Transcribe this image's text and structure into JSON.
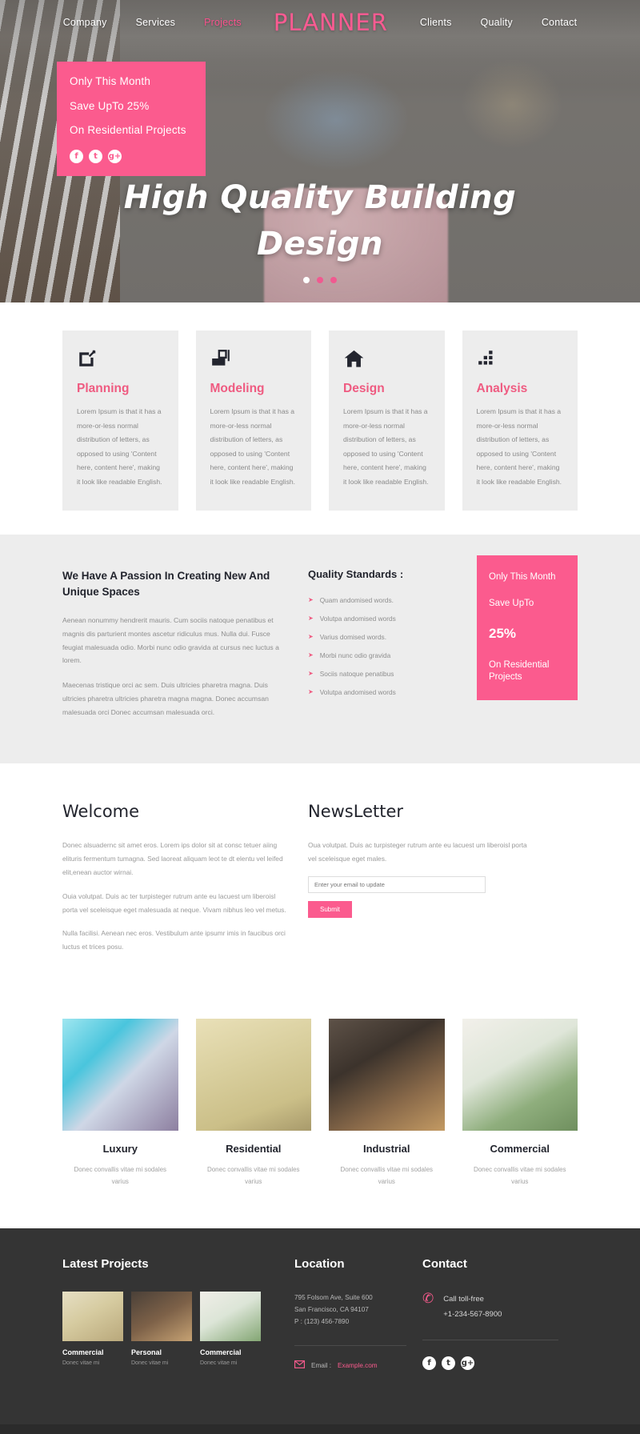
{
  "nav": {
    "brand": "PLANNER",
    "items": [
      {
        "label": "Company",
        "active": false
      },
      {
        "label": "Services",
        "active": false
      },
      {
        "label": "Projects",
        "active": true
      },
      {
        "label": "Clients",
        "active": false
      },
      {
        "label": "Quality",
        "active": false
      },
      {
        "label": "Contact",
        "active": false
      }
    ]
  },
  "hero": {
    "badge": {
      "line1": "Only This Month",
      "line2": "Save UpTo 25%",
      "line3": "On Residential Projects",
      "social": [
        "f",
        "t",
        "g+"
      ]
    },
    "title_line1": "High Quality Building",
    "title_line2": "Design",
    "dots": [
      true,
      false,
      false
    ]
  },
  "services": [
    {
      "icon": "edit-square-icon",
      "title": "Planning",
      "text": "Lorem Ipsum is that it has a more-or-less normal distribution of letters, as opposed to using 'Content here, content here', making it look like readable English."
    },
    {
      "icon": "monitor-icon",
      "title": "Modeling",
      "text": "Lorem Ipsum is that it has a more-or-less normal distribution of letters, as opposed to using 'Content here, content here', making it look like readable English."
    },
    {
      "icon": "home-icon",
      "title": "Design",
      "text": "Lorem Ipsum is that it has a more-or-less normal distribution of letters, as opposed to using 'Content here, content here', making it look like readable English."
    },
    {
      "icon": "bar-chart-icon",
      "title": "Analysis",
      "text": "Lorem Ipsum is that it has a more-or-less normal distribution of letters, as opposed to using 'Content here, content here', making it look like readable English."
    }
  ],
  "passion": {
    "heading": "We Have A Passion In Creating New And Unique Spaces",
    "para1": "Aenean nonummy hendrerit mauris. Cum sociis natoque penatibus et magnis dis parturient montes ascetur ridiculus mus. Nulla dui. Fusce feugiat malesuada odio. Morbi nunc odio gravida at cursus nec luctus a lorem.",
    "para2": "Maecenas tristique orci ac sem. Duis ultricies pharetra magna. Duis ultricies pharetra ultricies pharetra magna magna. Donec accumsan malesuada orci Donec accumsan malesuada orci.",
    "standards_heading": "Quality Standards :",
    "standards": [
      "Quam andomised words.",
      "Volutpa andomised words",
      "Varius domised words.",
      "Morbi nunc odio gravida",
      "Sociis natoque penatibus",
      "Volutpa andomised words"
    ],
    "promo": {
      "line1": "Only This Month",
      "line2": "Save UpTo",
      "line3": "25%",
      "line4": "On Residential Projects"
    }
  },
  "welcome": {
    "heading": "Welcome",
    "para1": "Donec alsuadernc sit amet eros. Lorem ips dolor sit at consc tetuer aiing elituris fermentum tumagna. Sed laoreat aliquam leot te dt elentu vel leifed elit,enean auctor wirnai.",
    "para2": "Ouia volutpat. Duis ac ter turpisteger rutrum ante eu lacuest um liberoisl porta vel sceleisque eget malesuada at neque. Vivam nibhus leo vel metus.",
    "para3": "Nulla facilisi. Aenean nec eros. Vestibulum ante ipsumr imis in faucibus orci luctus et trices posu."
  },
  "newsletter": {
    "heading": "NewsLetter",
    "text": "Oua volutpat. Duis ac turpisteger rutrum ante eu lacuest um liberoisl porta vel sceleisque eget males.",
    "placeholder": "Enter your email to update",
    "input_value": "",
    "submit_label": "Submit"
  },
  "gallery": [
    {
      "image": "luxury-photo",
      "title": "Luxury",
      "text": "Donec convallis vitae mi sodales varius"
    },
    {
      "image": "residential-photo",
      "title": "Residential",
      "text": "Donec convallis vitae mi sodales varius"
    },
    {
      "image": "industrial-photo",
      "title": "Industrial",
      "text": "Donec convallis vitae mi sodales varius"
    },
    {
      "image": "commercial-photo",
      "title": "Commercial",
      "text": "Donec convallis vitae mi sodales varius"
    }
  ],
  "footer": {
    "projects_heading": "Latest Projects",
    "projects": [
      {
        "title": "Commercial",
        "sub": "Donec vitae mi"
      },
      {
        "title": "Personal",
        "sub": "Donec vitae mi"
      },
      {
        "title": "Commercial",
        "sub": "Donec vitae mi"
      }
    ],
    "location_heading": "Location",
    "address_line1": "795 Folsom Ave, Suite 600",
    "address_line2": "San Francisco, CA 94107",
    "address_line3": "P : (123) 456-7890",
    "email_label": "Email :",
    "email_value": "Example.com",
    "contact_heading": "Contact",
    "call_label": "Call toll-free",
    "call_number": "+1-234-567-8900",
    "social": [
      "f",
      "t",
      "g+"
    ]
  },
  "colors": {
    "accent": "#fb5b8e",
    "accent_title": "#ef5b81",
    "dark": "#22242d",
    "footer_bg": "#343434",
    "panel_bg": "#ededed"
  }
}
